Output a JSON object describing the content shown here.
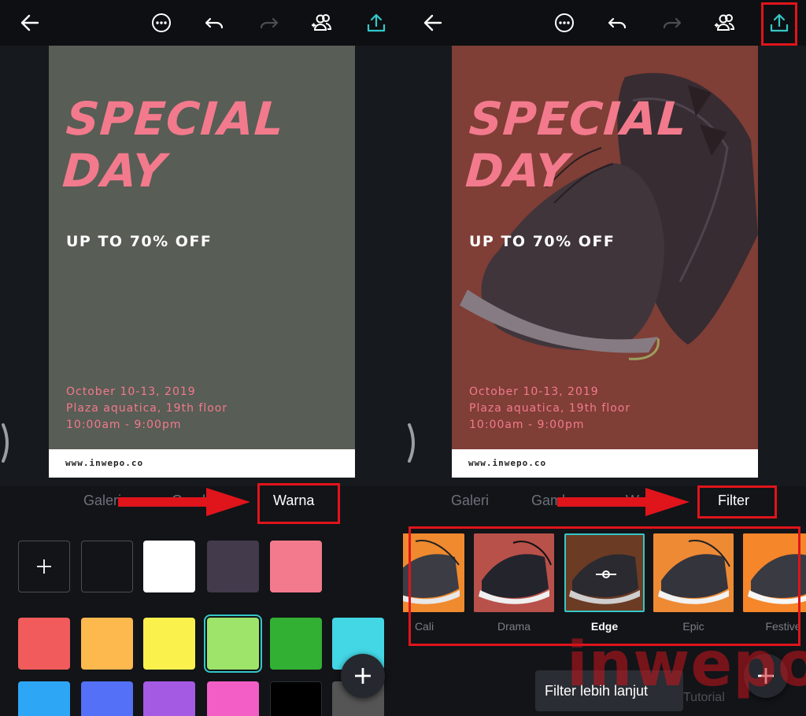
{
  "left_panel": {
    "poster": {
      "title_line1": "SPECIAL",
      "title_line2": "DAY",
      "offer": "UP TO 70% OFF",
      "detail_line1": "October 10-13, 2019",
      "detail_line2": "Plaza aquatica, 19th floor",
      "detail_line3": "10:00am - 9:00pm",
      "website": "www.inwepo.co",
      "background_color": "#585d55"
    },
    "tabs": {
      "tab1": "Galeri",
      "tab2": "Gambar",
      "active_tab": "Warna"
    },
    "swatches": {
      "row1": [
        "#121418",
        "#ffffff",
        "#433a4c",
        "#f27a8c"
      ],
      "row2": [
        "#f15b5b",
        "#fdb84e",
        "#fbf14d",
        "#9ee46a",
        "#32b033",
        "#43d6e4"
      ],
      "row3": [
        "#2ea6f6",
        "#5470f6",
        "#a55ae4",
        "#f25ec6",
        "#000000",
        "#555555"
      ],
      "selected_color": "#9ee46a"
    }
  },
  "right_panel": {
    "poster": {
      "title_line1": "SPECIAL",
      "title_line2": "DAY",
      "offer": "UP TO 70% OFF",
      "detail_line1": "October 10-13, 2019",
      "detail_line2": "Plaza aquatica, 19th floor",
      "detail_line3": "10:00am - 9:00pm",
      "website": "www.inwepo.co"
    },
    "tabs": {
      "tab1": "Galeri",
      "tab2": "Gambar",
      "tab3": "Warna",
      "active_tab": "Filter"
    },
    "filters": [
      "Cali",
      "Drama",
      "Edge",
      "Epic",
      "Festive"
    ],
    "selected_filter": "Edge",
    "tooltip": "Filter lebih lanjut",
    "tutorial_text": "Tutorial"
  },
  "watermark": "inwepo",
  "icons": [
    "back-arrow-icon",
    "more-options-icon",
    "undo-icon",
    "redo-icon",
    "share-people-icon",
    "upload-icon",
    "plus-icon"
  ],
  "colors": {
    "accent": "#34c8c8",
    "annotation_red": "#e0141b",
    "title_pink": "#f27a8c"
  }
}
